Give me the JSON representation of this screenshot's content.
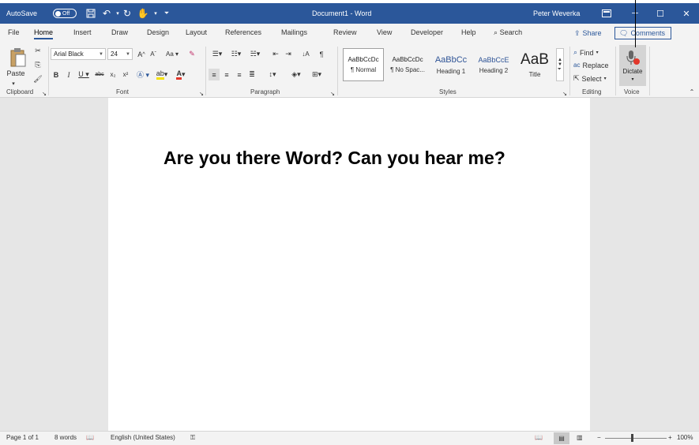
{
  "titlebar": {
    "autosave_label": "AutoSave",
    "autosave_state": "Off",
    "doc_title": "Document1  -  Word",
    "user_name": "Peter Weverka"
  },
  "tabs": [
    "File",
    "Home",
    "Insert",
    "Draw",
    "Design",
    "Layout",
    "References",
    "Mailings",
    "Review",
    "View",
    "Developer",
    "Help"
  ],
  "active_tab": "Home",
  "search_label": "Search",
  "share_label": "Share",
  "comments_label": "Comments",
  "font": {
    "name": "Arial Black",
    "size": "24"
  },
  "groups": {
    "clipboard": "Clipboard",
    "font": "Font",
    "paragraph": "Paragraph",
    "styles": "Styles",
    "editing": "Editing",
    "voice": "Voice"
  },
  "paste_label": "Paste",
  "styles": [
    {
      "sample": "AaBbCcDc",
      "name": "¶ Normal"
    },
    {
      "sample": "AaBbCcDc",
      "name": "¶ No Spac..."
    },
    {
      "sample": "AaBbCc",
      "name": "Heading 1"
    },
    {
      "sample": "AaBbCcE",
      "name": "Heading 2"
    },
    {
      "sample": "AaB",
      "name": "Title"
    }
  ],
  "editing": {
    "find": "Find",
    "replace": "Replace",
    "select": "Select"
  },
  "voice": {
    "dictate": "Dictate"
  },
  "document": {
    "text": "Are you there Word? Can you hear me?"
  },
  "status": {
    "page": "Page 1 of 1",
    "words": "8 words",
    "language": "English (United States)",
    "zoom": "100%"
  },
  "colors": {
    "accent": "#2b579a",
    "record": "#e2372b"
  }
}
